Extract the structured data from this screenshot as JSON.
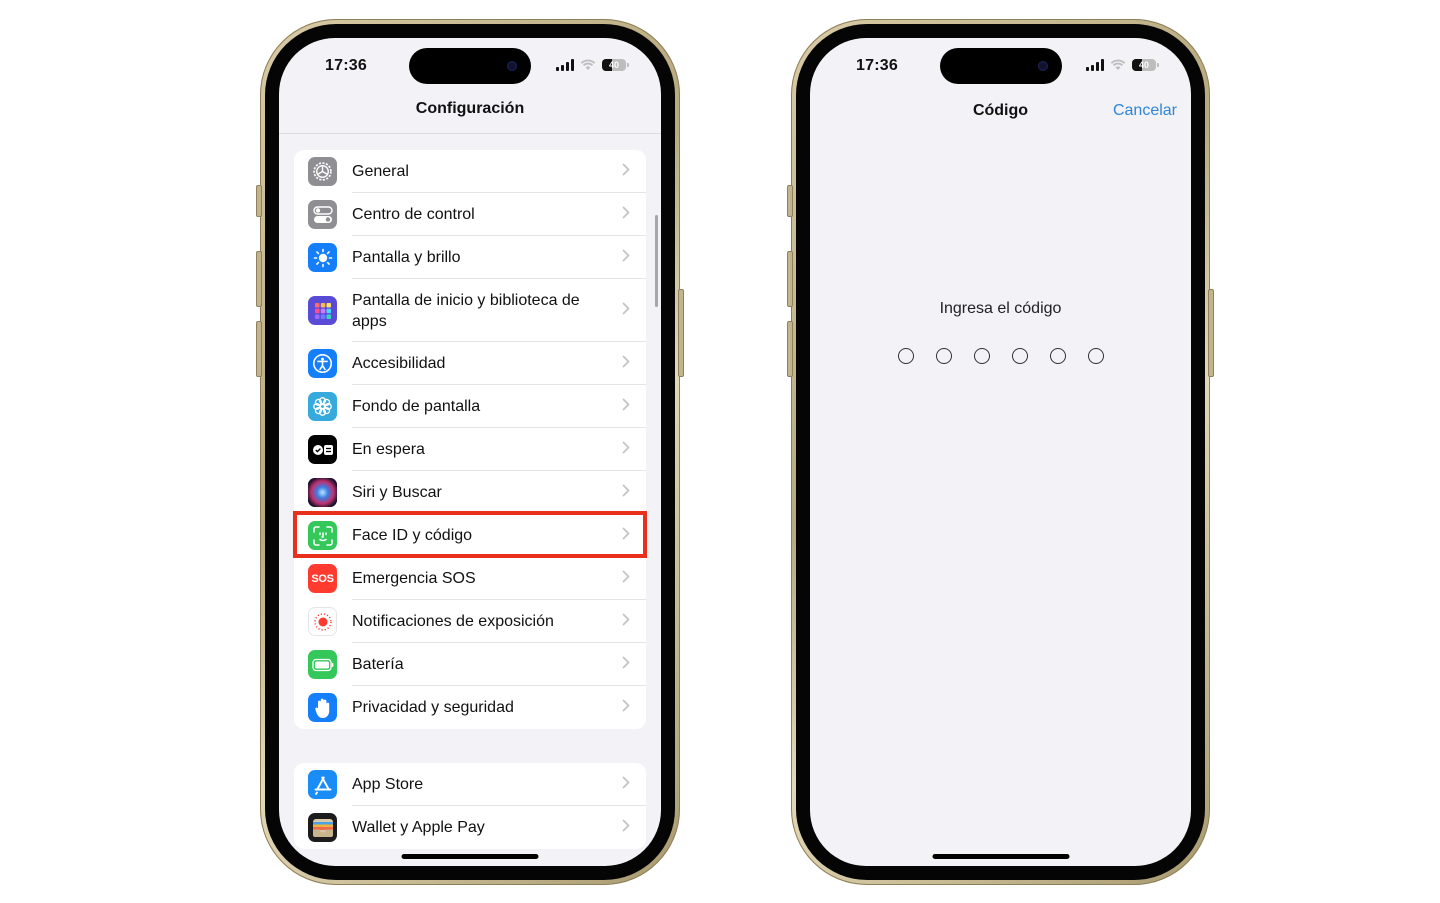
{
  "left_phone": {
    "status": {
      "time": "17:36",
      "battery": "40",
      "battery_level_percent": 40
    },
    "nav": {
      "title": "Configuración"
    },
    "groups": [
      {
        "items": [
          {
            "label": "General",
            "icon": "gear-icon",
            "color": "#8e8e93"
          },
          {
            "label": "Centro de control",
            "icon": "toggles-icon",
            "color": "#8e8e93"
          },
          {
            "label": "Pantalla y brillo",
            "icon": "sun-icon",
            "color": "#147efb"
          },
          {
            "label": "Pantalla de inicio y biblioteca de apps",
            "icon": "app-grid-icon",
            "color": "#5a4bd6"
          },
          {
            "label": "Accesibilidad",
            "icon": "accessibility-icon",
            "color": "#147efb"
          },
          {
            "label": "Fondo de pantalla",
            "icon": "flower-icon",
            "color": "#36aadc"
          },
          {
            "label": "En espera",
            "icon": "standby-icon",
            "color": "#000000"
          },
          {
            "label": "Siri y Buscar",
            "icon": "siri-icon",
            "color": "#2a2140"
          },
          {
            "label": "Face ID y código",
            "icon": "face-id-icon",
            "color": "#34c759",
            "highlighted": true
          },
          {
            "label": "Emergencia SOS",
            "icon": "sos-icon",
            "color": "#ff3b30",
            "icon_text": "SOS"
          },
          {
            "label": "Notificaciones de exposición",
            "icon": "exposure-icon",
            "color": "#ffffff"
          },
          {
            "label": "Batería",
            "icon": "battery-icon",
            "color": "#34c759"
          },
          {
            "label": "Privacidad y seguridad",
            "icon": "hand-icon",
            "color": "#147efb"
          }
        ]
      },
      {
        "items": [
          {
            "label": "App Store",
            "icon": "app-store-icon",
            "color": "#1a8cf5"
          },
          {
            "label": "Wallet y Apple Pay",
            "icon": "wallet-icon",
            "color": "#1c1c1e"
          }
        ]
      }
    ],
    "highlight_color": "#e8301c"
  },
  "right_phone": {
    "status": {
      "time": "17:36",
      "battery": "40",
      "battery_level_percent": 40
    },
    "nav": {
      "title": "Código",
      "cancel_label": "Cancelar"
    },
    "prompt": "Ingresa el código",
    "passcode": {
      "length": 6,
      "entered": 0
    },
    "accent_color": "#2f86d8"
  }
}
